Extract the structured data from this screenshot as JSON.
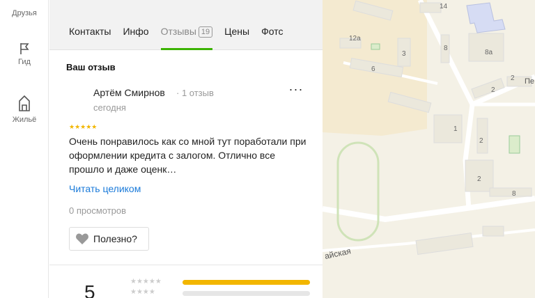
{
  "rail": [
    {
      "label": "Друзья",
      "icon": "friends-icon"
    },
    {
      "label": "Гид",
      "icon": "flag-icon"
    },
    {
      "label": "Жильё",
      "icon": "housing-icon"
    }
  ],
  "tabs": [
    {
      "label": "Контакты"
    },
    {
      "label": "Инфо"
    },
    {
      "label": "Отзывы",
      "count": "19",
      "active": true
    },
    {
      "label": "Цены"
    },
    {
      "label": "Фотс"
    }
  ],
  "review": {
    "header": "Ваш отзыв",
    "author": "Артём Смирнов",
    "author_meta": "· 1 отзыв",
    "date": "сегодня",
    "stars": "★★★★★",
    "rating": 5,
    "text": "Очень понравилось как со мной тут поработали при оформлении кредита с залогом. Отлично все прошло и даже оценк…",
    "read_more": "Читать целиком",
    "views": "0 просмотров",
    "useful": "Полезно?",
    "more": "···"
  },
  "summary": {
    "value": "5",
    "rows": [
      {
        "stars": "★★★★★",
        "fill": 1.0
      },
      {
        "stars": "★★★★",
        "fill": 0.0
      }
    ]
  },
  "map": {
    "labels": {
      "n14": "14",
      "n12a": "12а",
      "n6": "6",
      "n3": "3",
      "n8": "8",
      "n8a": "8а",
      "n2a": "2",
      "n2b": "2",
      "n1": "1",
      "n2c": "2",
      "n8b": "8",
      "n2d": "2",
      "street": "айская",
      "street2": "Пе"
    },
    "colors": {
      "background": "#f4f1e6",
      "park": "#f4ead0",
      "building": "#ebe8dc",
      "road": "#ffffff",
      "green": "#dbeccb",
      "blue": "#d6dcf4"
    }
  },
  "colors": {
    "accent": "#3cb300",
    "link": "#1a7ad9",
    "star": "#f2b600"
  }
}
